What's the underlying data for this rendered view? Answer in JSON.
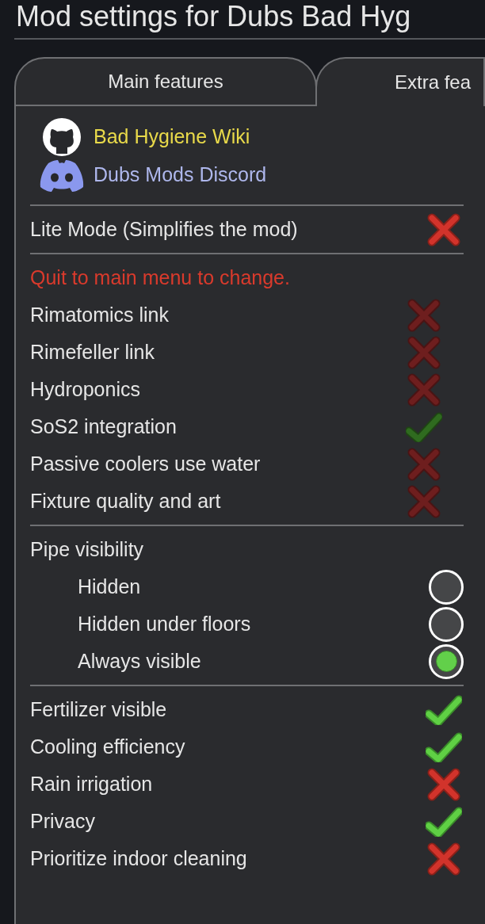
{
  "title": "Mod settings for Dubs Bad Hyg",
  "tabs": [
    {
      "label": "Main features",
      "selected": false
    },
    {
      "label": "Extra fea",
      "selected": true
    }
  ],
  "links": [
    {
      "kind": "github",
      "label": "Bad Hygiene Wiki"
    },
    {
      "kind": "discord",
      "label": "Dubs Mods Discord"
    }
  ],
  "sections": [
    {
      "kind": "toggles",
      "items": [
        {
          "label": "Lite Mode (Simplifies the mod)",
          "checked": false,
          "disabled": false
        }
      ]
    },
    {
      "kind": "toggles",
      "warning": "Quit to main menu to change.",
      "items": [
        {
          "label": "Rimatomics link",
          "checked": false,
          "disabled": true
        },
        {
          "label": "Rimefeller link",
          "checked": false,
          "disabled": true
        },
        {
          "label": "Hydroponics",
          "checked": false,
          "disabled": true
        },
        {
          "label": "SoS2 integration",
          "checked": true,
          "disabled": true
        },
        {
          "label": "Passive coolers use water",
          "checked": false,
          "disabled": true
        },
        {
          "label": "Fixture quality and art",
          "checked": false,
          "disabled": true
        }
      ]
    },
    {
      "kind": "radio",
      "heading": "Pipe visibility",
      "items": [
        {
          "label": "Hidden",
          "selected": false
        },
        {
          "label": "Hidden under floors",
          "selected": false
        },
        {
          "label": "Always visible",
          "selected": true
        }
      ]
    },
    {
      "kind": "toggles",
      "items": [
        {
          "label": "Fertilizer visible",
          "checked": true,
          "disabled": false
        },
        {
          "label": "Cooling efficiency",
          "checked": true,
          "disabled": false
        },
        {
          "label": "Rain irrigation",
          "checked": false,
          "disabled": false
        },
        {
          "label": "Privacy",
          "checked": true,
          "disabled": false
        },
        {
          "label": "Prioritize indoor cleaning",
          "checked": false,
          "disabled": false
        }
      ]
    }
  ]
}
